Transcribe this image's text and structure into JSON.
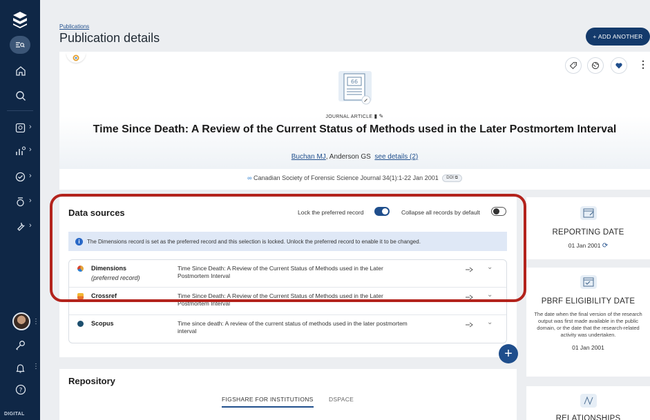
{
  "nav": {
    "footer_text": "DIGITAL"
  },
  "header": {
    "breadcrumb": "Publications",
    "title": "Publication details",
    "add_button": "+ ADD ANOTHER"
  },
  "publication": {
    "type_label": "JOURNAL ARTICLE",
    "title": "Time Since Death: A Review of the Current Status of Methods used in the Later Postmortem Interval",
    "author_link": "Buchan MJ",
    "author_rest": ", Anderson GS",
    "see_details": "see details (2)",
    "journal": "Canadian Society of Forensic Science Journal 34(1):1-22 Jan 2001",
    "doi_badge": "DOI"
  },
  "data_sources": {
    "title": "Data sources",
    "lock_label": "Lock the preferred record",
    "collapse_label": "Collapse all records by default",
    "info_text": "The Dimensions record is set as the preferred record and this selection is locked. Unlock the preferred record to enable it to be changed.",
    "rows": [
      {
        "name": "Dimensions",
        "sub": "(preferred record)",
        "title": "Time Since Death: A Review of the Current Status of Methods used in the Later Postmortem Interval",
        "color": "#e3a33a"
      },
      {
        "name": "Crossref",
        "sub": "",
        "title": "Time Since Death: A Review of the Current Status of Methods used in the Later Postmortem Interval",
        "color": "#e8712c"
      },
      {
        "name": "Scopus",
        "sub": "",
        "title": "Time since death: A review of the current status of methods used in the later postmortem interval",
        "color": "#1d4f6e"
      }
    ]
  },
  "repository": {
    "title": "Repository",
    "tab_active": "FIGSHARE FOR INSTITUTIONS",
    "tab_other": "DSPACE"
  },
  "side": {
    "reporting_title": "REPORTING DATE",
    "reporting_date": "01 Jan 2001",
    "pbrf_title": "PBRF ELIGIBILITY DATE",
    "pbrf_desc": "The date when the final version of the research output was first made available in the public domain, or the date that the research-related activity was undertaken.",
    "pbrf_date": "01 Jan 2001",
    "relationships_title": "RELATIONSHIPS"
  },
  "colors": {
    "nav_bg": "#0f2746",
    "accent": "#1f4e8c",
    "highlight": "#b3231c"
  }
}
